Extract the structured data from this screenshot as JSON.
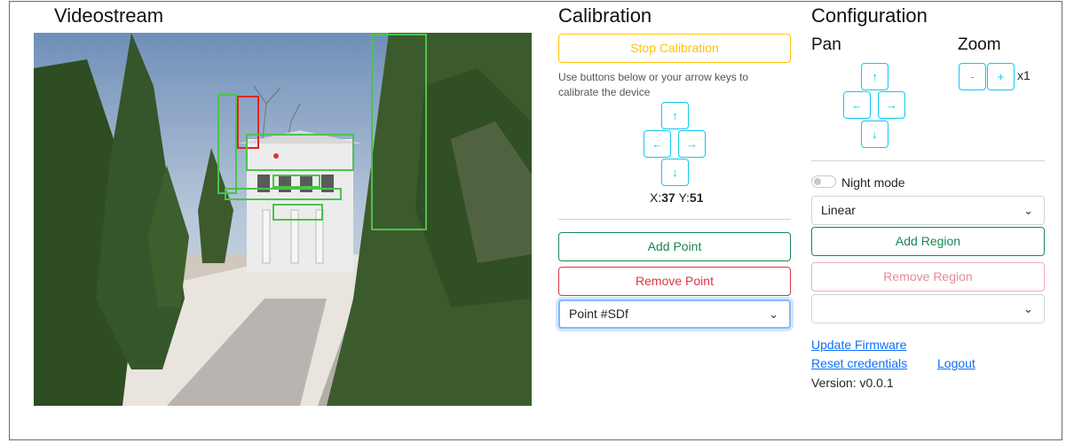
{
  "videostream": {
    "title": "Videostream"
  },
  "calibration": {
    "title": "Calibration",
    "stop_button": "Stop Calibration",
    "hint": "Use buttons below or your arrow keys to calibrate the device",
    "arrows": {
      "up": "↑",
      "left": "←",
      "right": "→",
      "down": "↓"
    },
    "coords": {
      "x_label": "X:",
      "x_value": "37",
      "y_label": "Y:",
      "y_value": "51"
    },
    "add_point": "Add Point",
    "remove_point": "Remove Point",
    "point_select": {
      "value": "Point #SDf"
    }
  },
  "configuration": {
    "title": "Configuration",
    "pan": {
      "label": "Pan",
      "arrows": {
        "up": "↑",
        "left": "←",
        "right": "→",
        "down": "↓"
      }
    },
    "zoom": {
      "label": "Zoom",
      "minus": "-",
      "plus": "+",
      "level": "x1"
    },
    "night_mode": {
      "label": "Night mode",
      "on": false
    },
    "mode_select": {
      "value": "Linear"
    },
    "add_region": "Add Region",
    "remove_region": "Remove Region",
    "region_select": {
      "value": ""
    },
    "links": {
      "update_firmware": "Update Firmware",
      "reset_credentials": "Reset credentials",
      "logout": "Logout"
    },
    "version": "Version: v0.0.1"
  },
  "colors": {
    "warning": "#ffc107",
    "success": "#198754",
    "danger": "#dc3545",
    "info": "#0dcaf0",
    "link": "#0d6efd",
    "region_box_green": "#4cc24c",
    "region_box_red": "#e02525"
  }
}
